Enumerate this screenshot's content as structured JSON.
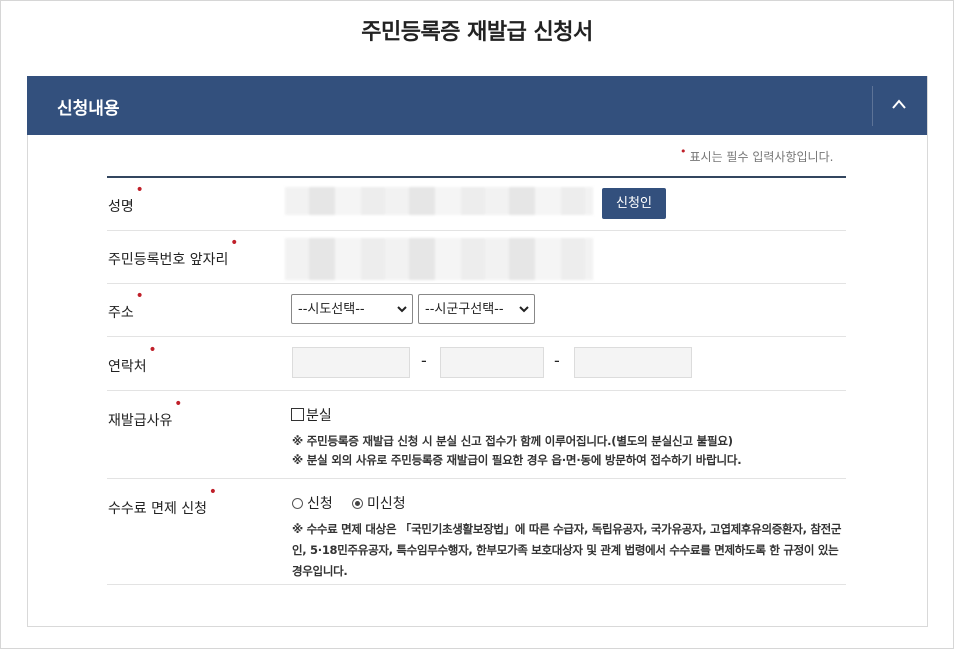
{
  "page": {
    "title": "주민등록증 재발급 신청서"
  },
  "panel": {
    "title": "신청내용",
    "collapse_icon": "chevron-up-icon",
    "header_color": "#33507d"
  },
  "required_note": {
    "marker": "•",
    "text": "표시는 필수 입력사항입니다."
  },
  "fields": {
    "name": {
      "label": "성명",
      "applicant_button": "신청인"
    },
    "resident_number": {
      "label": "주민등록번호 앞자리"
    },
    "address": {
      "label": "주소",
      "sido_select": "--시도선택--",
      "sigungu_select": "--시군구선택--"
    },
    "contact": {
      "label": "연락처",
      "separator": "-"
    },
    "reissue_reason": {
      "label": "재발급사유",
      "lost_option": "분실",
      "note1": "※ 주민등록증 재발급 신청 시 분실 신고 접수가 함께 이루어집니다.(별도의 분실신고 불필요)",
      "note2": "※ 분실 외의 사유로 주민등록증 재발급이 필요한 경우 읍·면·동에 방문하여 접수하기 바랍니다."
    },
    "fee_exemption": {
      "label": "수수료 면제 신청",
      "option_apply": "신청",
      "option_not_apply": "미신청",
      "selected": "미신청",
      "note": "※ 수수료 면제 대상은 「국민기초생활보장법」에 따른 수급자, 독립유공자, 국가유공자, 고엽제후유의증환자, 참전군인, 5·18민주유공자, 특수임무수행자, 한부모가족 보호대상자 및 관계 법령에서 수수료를 면제하도록 한 규정이 있는 경우입니다."
    }
  },
  "required_marker": "•"
}
